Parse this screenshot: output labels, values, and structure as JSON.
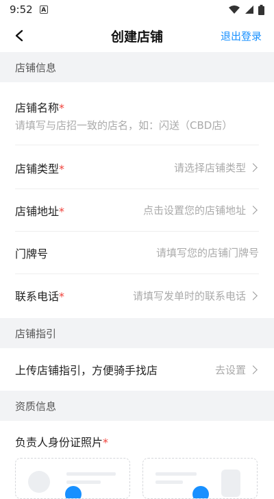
{
  "status_bar": {
    "time": "9:52",
    "notification_icon": "A"
  },
  "header": {
    "title": "创建店铺",
    "logout_label": "退出登录"
  },
  "sections": {
    "store_info": "店铺信息",
    "store_guide": "店铺指引",
    "qualification": "资质信息"
  },
  "store_name": {
    "label": "店铺名称",
    "required_mark": "*",
    "placeholder": "请填写与店招一致的店名，如：闪送（CBD店）"
  },
  "store_type": {
    "label": "店铺类型",
    "required_mark": "*",
    "value": "请选择店铺类型"
  },
  "store_address": {
    "label": "店铺地址",
    "required_mark": "*",
    "value": "点击设置您的店铺地址"
  },
  "door_number": {
    "label": "门牌号",
    "value": "请填写您的店铺门牌号"
  },
  "contact_phone": {
    "label": "联系电话",
    "required_mark": "*",
    "value": "请填写发单时的联系电话"
  },
  "guide_upload": {
    "label": "上传店铺指引，方便骑手找店",
    "value": "去设置"
  },
  "id_photo": {
    "label": "负责人身份证照片",
    "required_mark": "*"
  },
  "colors": {
    "accent": "#1890ff",
    "required": "#f0413a",
    "section_bg": "#f2f3f5"
  },
  "icons": [
    "back-arrow-icon",
    "chevron-right-icon",
    "wifi-icon",
    "signal-icon",
    "battery-icon",
    "id-card-front-icon",
    "id-card-back-icon",
    "camera-icon"
  ]
}
